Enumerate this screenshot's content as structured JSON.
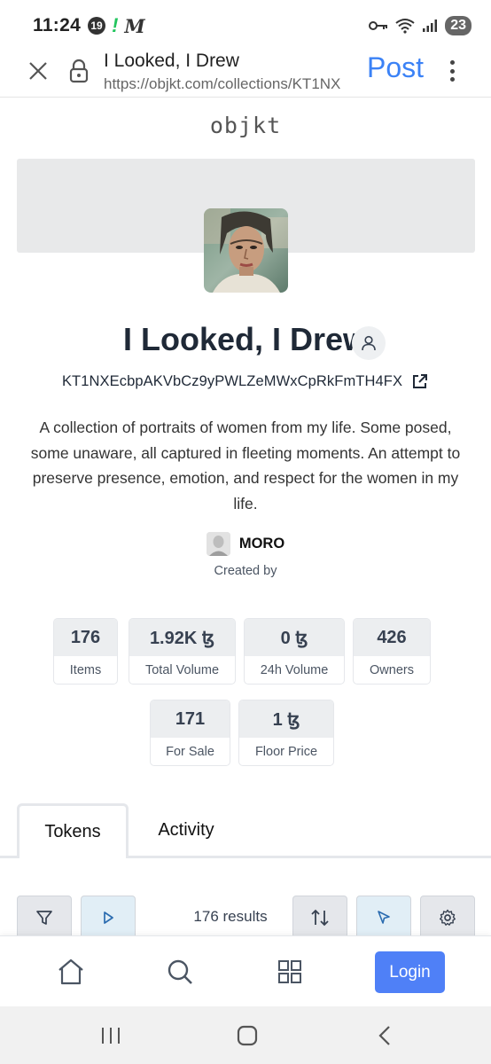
{
  "status_bar": {
    "time": "11:24",
    "notif_badge": "19",
    "battery": "23"
  },
  "browser": {
    "title": "I Looked, I Drew",
    "url": "https://objkt.com/collections/KT1NX",
    "post_label": "Post"
  },
  "site": {
    "logo": "objkt"
  },
  "collection": {
    "title": "I Looked, I Drew",
    "address": "KT1NXEcbpAKVbCz9yPWLZeMWxCpRkFmTH4FX",
    "description": "A collection of portraits of women from my life. Some posed, some unaware, all captured in fleeting moments. An attempt to preserve presence, emotion, and respect for the women in my life.",
    "creator_name": "MORO",
    "created_by_label": "Created by"
  },
  "stats": [
    {
      "value": "176",
      "label": "Items"
    },
    {
      "value": "1.92K ꜩ",
      "label": "Total Volume"
    },
    {
      "value": "0 ꜩ",
      "label": "24h Volume"
    },
    {
      "value": "426",
      "label": "Owners"
    },
    {
      "value": "171",
      "label": "For Sale"
    },
    {
      "value": "1 ꜩ",
      "label": "Floor Price"
    }
  ],
  "tabs": [
    {
      "label": "Tokens",
      "active": true
    },
    {
      "label": "Activity",
      "active": false
    }
  ],
  "toolbar": {
    "results": "176 results"
  },
  "bottom_nav": {
    "login_label": "Login"
  },
  "colors": {
    "accent": "#4f80f7",
    "post_blue": "#3b82f6",
    "stat_bg": "#eceef0"
  }
}
